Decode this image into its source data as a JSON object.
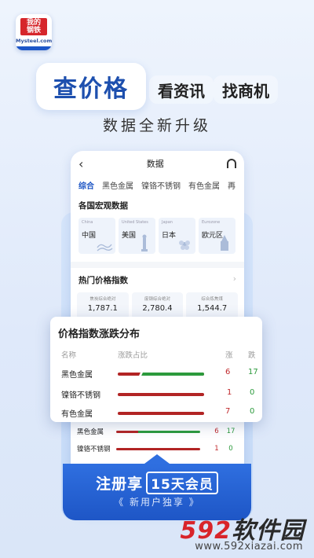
{
  "logo": {
    "line1": "我的",
    "line2": "钢铁",
    "sub": "Mysteel.com"
  },
  "top_tabs": {
    "main": "查价格",
    "second": "看资讯",
    "third": "找商机"
  },
  "subtitle": "数据全新升级",
  "phone": {
    "title": "数据",
    "tabs": [
      "综合",
      "黑色金属",
      "镍铬不锈钢",
      "有色金属",
      "再"
    ],
    "macro_title": "各国宏观数据",
    "countries": [
      {
        "en": "China",
        "cn": "中国"
      },
      {
        "en": "United States",
        "cn": "美国"
      },
      {
        "en": "Japan",
        "cn": "日本"
      },
      {
        "en": "Eurozone",
        "cn": "欧元区"
      }
    ],
    "hot_title": "热门价格指数",
    "indices": [
      {
        "name": "焦炭综合绝对",
        "value": "1,787.1"
      },
      {
        "name": "废钢综合绝对",
        "value": "2,780.4"
      },
      {
        "name": "综合炼焦煤",
        "value": "1,544.7"
      }
    ],
    "mini_rows": [
      {
        "label": "黑色金属",
        "up": "6",
        "down": "17"
      },
      {
        "label": "镍铬不锈钢",
        "up": "1",
        "down": "0"
      }
    ]
  },
  "card": {
    "title": "价格指数涨跌分布",
    "headers": {
      "name": "名称",
      "ratio": "涨跌占比",
      "up": "涨",
      "down": "跌"
    },
    "rows": [
      {
        "label": "黑色金属",
        "up": "6",
        "down": "17",
        "up_fraction": 0.26
      },
      {
        "label": "镍铬不锈钢",
        "up": "1",
        "down": "0",
        "up_fraction": 1.0
      },
      {
        "label": "有色金属",
        "up": "7",
        "down": "0",
        "up_fraction": 1.0
      }
    ]
  },
  "cta": {
    "prefix": "注册享",
    "boxed": "15天会员",
    "sub": "《 新用户独享 》"
  },
  "watermark": {
    "num": "592",
    "cn": "软件园",
    "url": "www.592xiazai.com"
  },
  "colors": {
    "brand_blue": "#1d4fae",
    "up_red": "#c0282b",
    "down_green": "#2c9a3c"
  }
}
